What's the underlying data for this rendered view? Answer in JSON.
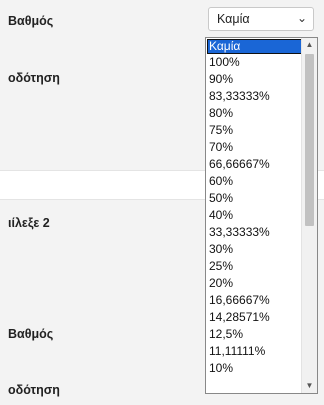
{
  "rows": {
    "grade_label_1": "Βαθμός",
    "feedback_label_1": "οδότηση",
    "choice_label": "ιίλεξε 2",
    "grade_label_2": "Βαθμός",
    "feedback_label_2": "οδότηση"
  },
  "grade_select": {
    "value": "Καμία",
    "options": [
      "Καμία",
      "100%",
      "90%",
      "83,33333%",
      "80%",
      "75%",
      "70%",
      "66,66667%",
      "60%",
      "50%",
      "40%",
      "33,33333%",
      "30%",
      "25%",
      "20%",
      "16,66667%",
      "14,28571%",
      "12,5%",
      "11,11111%",
      "10%"
    ],
    "selected_index": 0
  },
  "icons": {
    "chevron": "chevron-down-icon",
    "scroll_up": "scroll-up-arrow-icon",
    "scroll_down": "scroll-down-arrow-icon"
  },
  "colors": {
    "selected_bg": "#1a66d6",
    "panel_bg": "#f3f3f3"
  }
}
